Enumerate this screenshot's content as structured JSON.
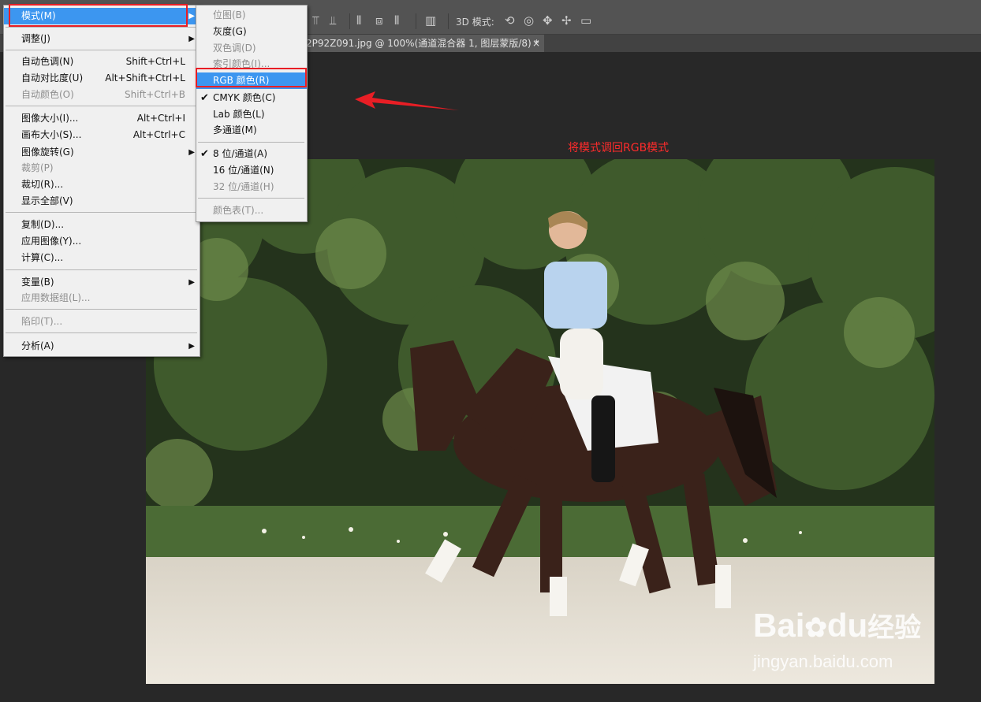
{
  "options_bar": {
    "mode_3d_label": "3D 模式:"
  },
  "document_tab": {
    "title": "2P92Z091.jpg @ 100%(通道混合器 1, 图层蒙版/8) *",
    "close": "×"
  },
  "annotation": {
    "text": "将模式调回RGB模式",
    "color": "#ff2b2b"
  },
  "image_menu": {
    "items": [
      {
        "label": "模式(M)",
        "submenu": true,
        "highlighted": true
      },
      {
        "label": "调整(J)",
        "submenu": true
      },
      {
        "label": "自动色调(N)",
        "shortcut": "Shift+Ctrl+L"
      },
      {
        "label": "自动对比度(U)",
        "shortcut": "Alt+Shift+Ctrl+L"
      },
      {
        "label": "自动颜色(O)",
        "shortcut": "Shift+Ctrl+B",
        "disabled": true
      },
      {
        "label": "图像大小(I)...",
        "shortcut": "Alt+Ctrl+I"
      },
      {
        "label": "画布大小(S)...",
        "shortcut": "Alt+Ctrl+C"
      },
      {
        "label": "图像旋转(G)",
        "submenu": true
      },
      {
        "label": "裁剪(P)",
        "disabled": true
      },
      {
        "label": "裁切(R)..."
      },
      {
        "label": "显示全部(V)"
      },
      {
        "label": "复制(D)..."
      },
      {
        "label": "应用图像(Y)..."
      },
      {
        "label": "计算(C)..."
      },
      {
        "label": "变量(B)",
        "submenu": true
      },
      {
        "label": "应用数据组(L)...",
        "disabled": true
      },
      {
        "label": "陷印(T)...",
        "disabled": true
      },
      {
        "label": "分析(A)",
        "submenu": true
      }
    ]
  },
  "mode_submenu": {
    "items": [
      {
        "label": "位图(B)",
        "disabled": true
      },
      {
        "label": "灰度(G)"
      },
      {
        "label": "双色调(D)",
        "disabled": true
      },
      {
        "label": "索引颜色(I)...",
        "disabled": true
      },
      {
        "label": "RGB 颜色(R)",
        "highlighted": true
      },
      {
        "label": "CMYK 颜色(C)",
        "checked": true
      },
      {
        "label": "Lab 颜色(L)"
      },
      {
        "label": "多通道(M)"
      },
      {
        "label": "8 位/通道(A)",
        "checked": true
      },
      {
        "label": "16 位/通道(N)"
      },
      {
        "label": "32 位/通道(H)",
        "disabled": true
      },
      {
        "label": "颜色表(T)...",
        "disabled": true
      }
    ]
  },
  "watermark": {
    "brand_left": "Bai",
    "brand_mid": "du",
    "brand_right": "经验",
    "url": "jingyan.baidu.com"
  },
  "colors": {
    "menu_highlight": "#3c96f0",
    "red_marker": "#e81e25",
    "panel_gray": "#535353",
    "workspace": "#282828"
  }
}
